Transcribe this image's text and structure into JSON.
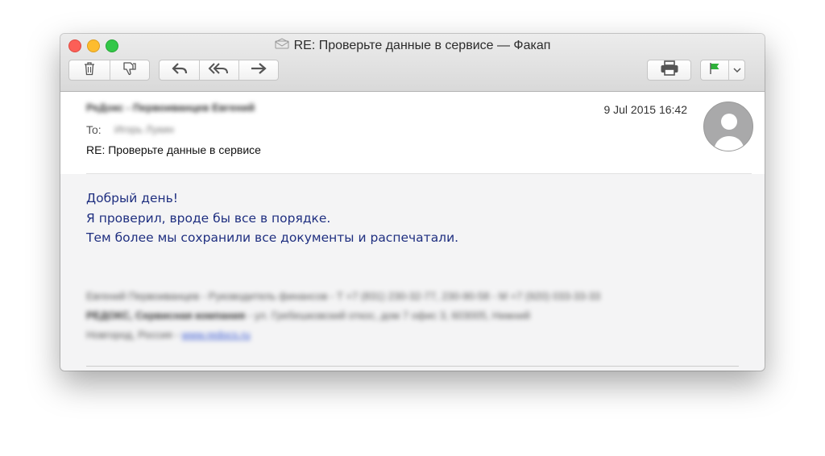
{
  "window": {
    "title": "RE: Проверьте данные в сервисе — Факап"
  },
  "toolbar": {
    "buttons": [
      {
        "name": "delete",
        "icon": "trash-icon"
      },
      {
        "name": "junk",
        "icon": "thumbs-down-icon"
      },
      {
        "name": "reply",
        "icon": "reply-icon"
      },
      {
        "name": "reply-all",
        "icon": "reply-all-icon"
      },
      {
        "name": "forward",
        "icon": "forward-icon"
      },
      {
        "name": "print",
        "icon": "printer-icon"
      },
      {
        "name": "flag",
        "icon": "flag-icon",
        "color": "#2fb13a"
      },
      {
        "name": "flag-menu",
        "icon": "chevron-down-icon"
      }
    ]
  },
  "message": {
    "from": "РеДокс - Первоиванцев Евгений",
    "to_label": "To:",
    "to": "Игорь Лукин",
    "subject": "RE: Проверьте данные в сервисе",
    "date": "9 Jul 2015 16:42",
    "body": [
      "Добрый день!",
      "Я проверил, вроде бы все в порядке.",
      "Тем более мы сохранили все документы и распечатали."
    ],
    "body_color": "#1f2f80",
    "signature": {
      "line1": "Евгений Первоиванцев - Руководитель финансов - T +7 (831) 230-32-77, 230-90-58 - M +7 (920) 033-33-33",
      "line2_bold": "РЕДОКС, Сервисная компания",
      "line2": " - ул. Гребешковский откос, дом 7 офис 3, 603005, Нижний",
      "line3": "Новгород, Россия - ",
      "link": "www.redocs.ru"
    }
  }
}
